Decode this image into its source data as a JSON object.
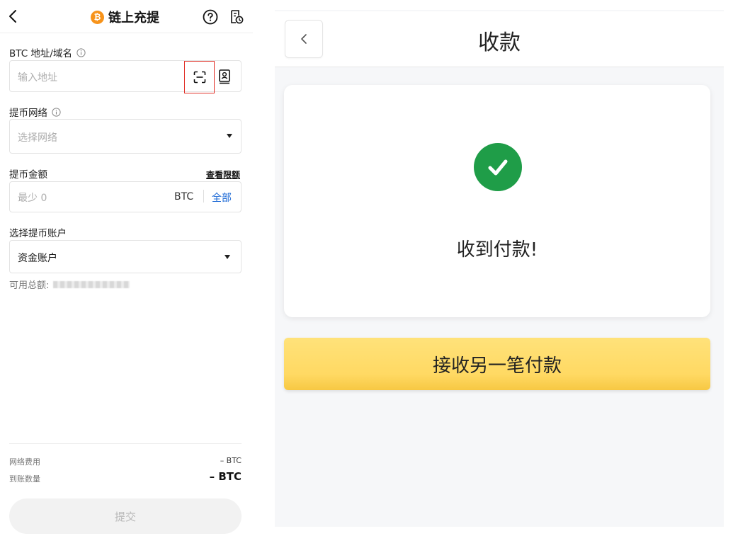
{
  "left": {
    "header": {
      "title": "链上充提",
      "coin_glyph": "₿"
    },
    "address": {
      "label": "BTC 地址/域名",
      "placeholder": "输入地址"
    },
    "network": {
      "label": "提币网络",
      "placeholder": "选择网络"
    },
    "amount": {
      "label": "提币金额",
      "limit_link": "查看限额",
      "placeholder": "最少 0",
      "unit": "BTC",
      "all_label": "全部"
    },
    "account": {
      "label": "选择提币账户",
      "value": "资金账户"
    },
    "available_label": "可用总额:",
    "fees": {
      "network_fee_label": "网络费用",
      "network_fee_value": "– BTC",
      "receive_label": "到账数量",
      "receive_value": "– BTC"
    },
    "submit_label": "提交"
  },
  "right": {
    "title": "收款",
    "success_message": "收到付款!",
    "again_button": "接收另一笔付款"
  },
  "colors": {
    "accent_blue": "#1f6bd6",
    "btc_orange": "#f7931a",
    "success_green": "#1f9d48",
    "highlight_red": "#e2342c",
    "button_yellow": "#ffd963"
  }
}
